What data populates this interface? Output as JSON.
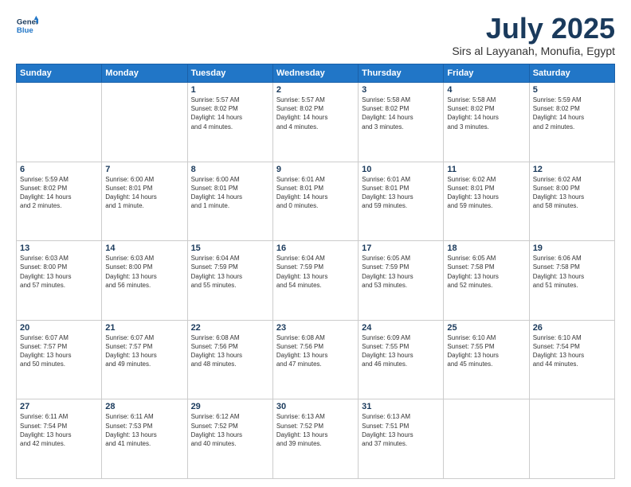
{
  "header": {
    "logo_line1": "General",
    "logo_line2": "Blue",
    "title": "July 2025",
    "location": "Sirs al Layyanah, Monufia, Egypt"
  },
  "weekdays": [
    "Sunday",
    "Monday",
    "Tuesday",
    "Wednesday",
    "Thursday",
    "Friday",
    "Saturday"
  ],
  "weeks": [
    [
      {
        "day": "",
        "info": ""
      },
      {
        "day": "",
        "info": ""
      },
      {
        "day": "1",
        "info": "Sunrise: 5:57 AM\nSunset: 8:02 PM\nDaylight: 14 hours\nand 4 minutes."
      },
      {
        "day": "2",
        "info": "Sunrise: 5:57 AM\nSunset: 8:02 PM\nDaylight: 14 hours\nand 4 minutes."
      },
      {
        "day": "3",
        "info": "Sunrise: 5:58 AM\nSunset: 8:02 PM\nDaylight: 14 hours\nand 3 minutes."
      },
      {
        "day": "4",
        "info": "Sunrise: 5:58 AM\nSunset: 8:02 PM\nDaylight: 14 hours\nand 3 minutes."
      },
      {
        "day": "5",
        "info": "Sunrise: 5:59 AM\nSunset: 8:02 PM\nDaylight: 14 hours\nand 2 minutes."
      }
    ],
    [
      {
        "day": "6",
        "info": "Sunrise: 5:59 AM\nSunset: 8:02 PM\nDaylight: 14 hours\nand 2 minutes."
      },
      {
        "day": "7",
        "info": "Sunrise: 6:00 AM\nSunset: 8:01 PM\nDaylight: 14 hours\nand 1 minute."
      },
      {
        "day": "8",
        "info": "Sunrise: 6:00 AM\nSunset: 8:01 PM\nDaylight: 14 hours\nand 1 minute."
      },
      {
        "day": "9",
        "info": "Sunrise: 6:01 AM\nSunset: 8:01 PM\nDaylight: 14 hours\nand 0 minutes."
      },
      {
        "day": "10",
        "info": "Sunrise: 6:01 AM\nSunset: 8:01 PM\nDaylight: 13 hours\nand 59 minutes."
      },
      {
        "day": "11",
        "info": "Sunrise: 6:02 AM\nSunset: 8:01 PM\nDaylight: 13 hours\nand 59 minutes."
      },
      {
        "day": "12",
        "info": "Sunrise: 6:02 AM\nSunset: 8:00 PM\nDaylight: 13 hours\nand 58 minutes."
      }
    ],
    [
      {
        "day": "13",
        "info": "Sunrise: 6:03 AM\nSunset: 8:00 PM\nDaylight: 13 hours\nand 57 minutes."
      },
      {
        "day": "14",
        "info": "Sunrise: 6:03 AM\nSunset: 8:00 PM\nDaylight: 13 hours\nand 56 minutes."
      },
      {
        "day": "15",
        "info": "Sunrise: 6:04 AM\nSunset: 7:59 PM\nDaylight: 13 hours\nand 55 minutes."
      },
      {
        "day": "16",
        "info": "Sunrise: 6:04 AM\nSunset: 7:59 PM\nDaylight: 13 hours\nand 54 minutes."
      },
      {
        "day": "17",
        "info": "Sunrise: 6:05 AM\nSunset: 7:59 PM\nDaylight: 13 hours\nand 53 minutes."
      },
      {
        "day": "18",
        "info": "Sunrise: 6:05 AM\nSunset: 7:58 PM\nDaylight: 13 hours\nand 52 minutes."
      },
      {
        "day": "19",
        "info": "Sunrise: 6:06 AM\nSunset: 7:58 PM\nDaylight: 13 hours\nand 51 minutes."
      }
    ],
    [
      {
        "day": "20",
        "info": "Sunrise: 6:07 AM\nSunset: 7:57 PM\nDaylight: 13 hours\nand 50 minutes."
      },
      {
        "day": "21",
        "info": "Sunrise: 6:07 AM\nSunset: 7:57 PM\nDaylight: 13 hours\nand 49 minutes."
      },
      {
        "day": "22",
        "info": "Sunrise: 6:08 AM\nSunset: 7:56 PM\nDaylight: 13 hours\nand 48 minutes."
      },
      {
        "day": "23",
        "info": "Sunrise: 6:08 AM\nSunset: 7:56 PM\nDaylight: 13 hours\nand 47 minutes."
      },
      {
        "day": "24",
        "info": "Sunrise: 6:09 AM\nSunset: 7:55 PM\nDaylight: 13 hours\nand 46 minutes."
      },
      {
        "day": "25",
        "info": "Sunrise: 6:10 AM\nSunset: 7:55 PM\nDaylight: 13 hours\nand 45 minutes."
      },
      {
        "day": "26",
        "info": "Sunrise: 6:10 AM\nSunset: 7:54 PM\nDaylight: 13 hours\nand 44 minutes."
      }
    ],
    [
      {
        "day": "27",
        "info": "Sunrise: 6:11 AM\nSunset: 7:54 PM\nDaylight: 13 hours\nand 42 minutes."
      },
      {
        "day": "28",
        "info": "Sunrise: 6:11 AM\nSunset: 7:53 PM\nDaylight: 13 hours\nand 41 minutes."
      },
      {
        "day": "29",
        "info": "Sunrise: 6:12 AM\nSunset: 7:52 PM\nDaylight: 13 hours\nand 40 minutes."
      },
      {
        "day": "30",
        "info": "Sunrise: 6:13 AM\nSunset: 7:52 PM\nDaylight: 13 hours\nand 39 minutes."
      },
      {
        "day": "31",
        "info": "Sunrise: 6:13 AM\nSunset: 7:51 PM\nDaylight: 13 hours\nand 37 minutes."
      },
      {
        "day": "",
        "info": ""
      },
      {
        "day": "",
        "info": ""
      }
    ]
  ]
}
